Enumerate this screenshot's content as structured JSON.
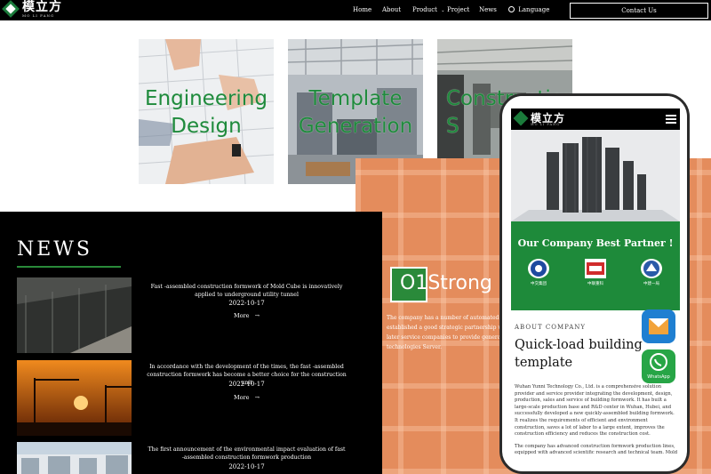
{
  "header": {
    "logo_cn": "模立方",
    "logo_en": "MO LI FANG",
    "nav": [
      "Home",
      "About",
      "Product",
      "Project",
      "News",
      "Language"
    ],
    "contact": "Contact Us"
  },
  "tiles": [
    {
      "title": "Engineering Design"
    },
    {
      "title": "Template Generation"
    },
    {
      "title": "Construction S"
    }
  ],
  "strong": {
    "text": "Strong Co",
    "logo_text": "O1",
    "desc": "The company has a number of automated pr... established a good strategic partnership with... later service companies to provide general c... technologies Server."
  },
  "news": {
    "heading": "NEWS",
    "more_label": "More",
    "items": [
      {
        "title": "Fast -assembled construction formwork of Mold Cube is innovatively applied to underground utility tunnel",
        "date": "2022-10-17"
      },
      {
        "title": "In accordance with the development of the times, the fast -assembled construction formwork has become a better choice for the construction unit",
        "date": "2022-10-17"
      },
      {
        "title": "The first announcement of the environmental impact evaluation of fast -assembled construction formwork production",
        "date": "2022-10-17"
      }
    ]
  },
  "phone": {
    "logo_cn": "模立方",
    "logo_en": "MO LI FANG",
    "partner_title": "Our Company Best Partner !",
    "partners": [
      "中交集团",
      "中联重科",
      "中建一局"
    ],
    "about_label": "ABOUT COMPANY",
    "about_title": "Quick-load building template",
    "body": "Wuhan Yunni Technology Co., Ltd. is a comprehensive solution provider and service provider integrating the development, design, production, sales and service of building formwork. It has built a large-scale production base and R&D center in Wuhan, Hubei, and successfully developed a new quickly-assembled building formwork. It realizes the requirements of efficient and environment construction, saves a lot of labor to a large extent, improves the construction efficiency and reduces the construction cost.",
    "body2": "The company has advanced construction formwork production lines, equipped with advanced scientific research and technical team. Mold",
    "whatsapp": "WhatsApp"
  },
  "colors": {
    "accent_green": "#1e8a3a",
    "orange_bg": "#e48c5c",
    "news_bg": "#000000"
  }
}
